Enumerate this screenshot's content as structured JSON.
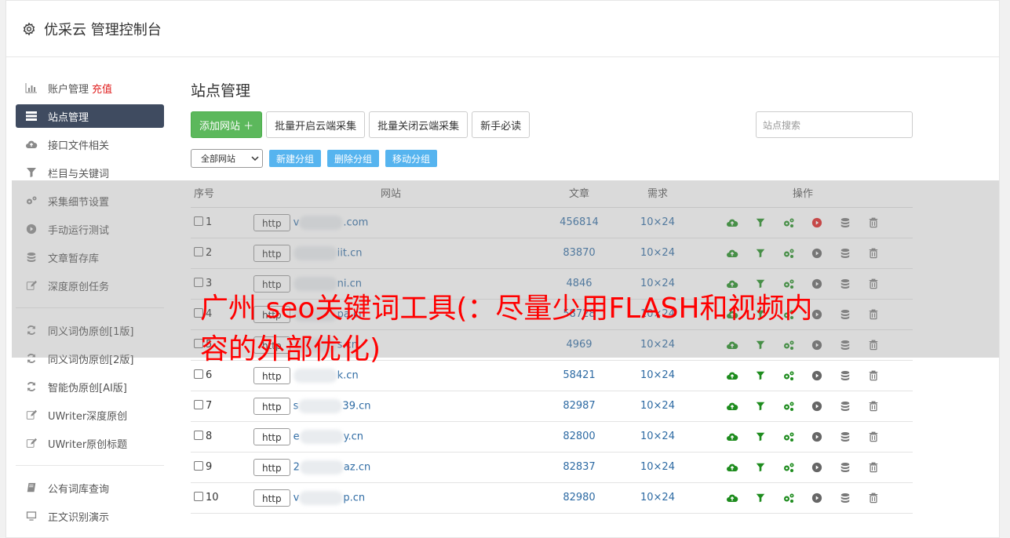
{
  "app": {
    "title": "优采云 管理控制台"
  },
  "sidebar": {
    "items": [
      {
        "label": "账户管理",
        "extra": "充值",
        "icon": "bar-chart-icon"
      },
      {
        "label": "站点管理",
        "icon": "server-icon",
        "active": true
      },
      {
        "label": "接口文件相关",
        "icon": "cloud-upload-icon"
      },
      {
        "label": "栏目与关键词",
        "icon": "filter-icon"
      },
      {
        "label": "采集细节设置",
        "icon": "gears-icon"
      },
      {
        "label": "手动运行测试",
        "icon": "play-circle-icon"
      },
      {
        "label": "文章暂存库",
        "icon": "database-icon"
      },
      {
        "label": "深度原创任务",
        "icon": "edit-icon"
      }
    ],
    "items2": [
      {
        "label": "同义词伪原创[1版]",
        "icon": "refresh-icon"
      },
      {
        "label": "同义词伪原创[2版]",
        "icon": "refresh-icon"
      },
      {
        "label": "智能伪原创[AI版]",
        "icon": "refresh-icon"
      },
      {
        "label": "UWriter深度原创",
        "icon": "edit-icon"
      },
      {
        "label": "UWriter原创标题",
        "icon": "edit-icon"
      }
    ],
    "items3": [
      {
        "label": "公有词库查询",
        "icon": "book-icon"
      },
      {
        "label": "正文识别演示",
        "icon": "monitor-icon"
      }
    ]
  },
  "main": {
    "title": "站点管理",
    "toolbar": {
      "add_label": "添加网站 ＋",
      "batch_on_label": "批量开启云端采集",
      "batch_off_label": "批量关闭云端采集",
      "guide_label": "新手必读",
      "search_placeholder": "站点搜索"
    },
    "group": {
      "select_value": "全部网站",
      "new_label": "新建分组",
      "delete_label": "删除分组",
      "move_label": "移动分组"
    },
    "table": {
      "headers": {
        "no": "序号",
        "site": "网站",
        "articles": "文章",
        "demand": "需求",
        "ops": "操作"
      },
      "rows": [
        {
          "no": "1",
          "protocol": "http",
          "prefix": "v",
          "suffix": ".com",
          "articles": "456814",
          "demand": "10×24",
          "running": true
        },
        {
          "no": "2",
          "protocol": "http",
          "prefix": "",
          "suffix": "iit.cn",
          "articles": "83870",
          "demand": "10×24",
          "running": false
        },
        {
          "no": "3",
          "protocol": "http",
          "prefix": "",
          "suffix": "ni.cn",
          "articles": "4846",
          "demand": "10×24",
          "running": false
        },
        {
          "no": "4",
          "protocol": "http",
          "prefix": "",
          "suffix": "pa.cn",
          "articles": "58728",
          "demand": "10×24",
          "running": false
        },
        {
          "no": "5",
          "protocol": "http",
          "prefix": "",
          "suffix": "s.cn",
          "articles": "4969",
          "demand": "10×24",
          "running": false
        },
        {
          "no": "6",
          "protocol": "http",
          "prefix": "",
          "suffix": "k.cn",
          "articles": "58421",
          "demand": "10×24",
          "running": false
        },
        {
          "no": "7",
          "protocol": "http",
          "prefix": "s",
          "suffix": "39.cn",
          "articles": "82987",
          "demand": "10×24",
          "running": false
        },
        {
          "no": "8",
          "protocol": "http",
          "prefix": "e",
          "suffix": "y.cn",
          "articles": "82800",
          "demand": "10×24",
          "running": false
        },
        {
          "no": "9",
          "protocol": "http",
          "prefix": "2",
          "suffix": "az.cn",
          "articles": "82837",
          "demand": "10×24",
          "running": false
        },
        {
          "no": "10",
          "protocol": "http",
          "prefix": "v",
          "suffix": "p.cn",
          "articles": "82980",
          "demand": "10×24",
          "running": false
        }
      ]
    }
  },
  "overlay": {
    "headline": "广州 seo关键词工具(：尽量少用FLASH和视频内容的外部优化)"
  },
  "colors": {
    "green": "#5cb85c",
    "blue_button": "#56b4ef",
    "sidebar_active": "#3f4b60",
    "link": "#2d6aa3",
    "danger": "#e02020",
    "icon_green": "#1e8c1e"
  }
}
